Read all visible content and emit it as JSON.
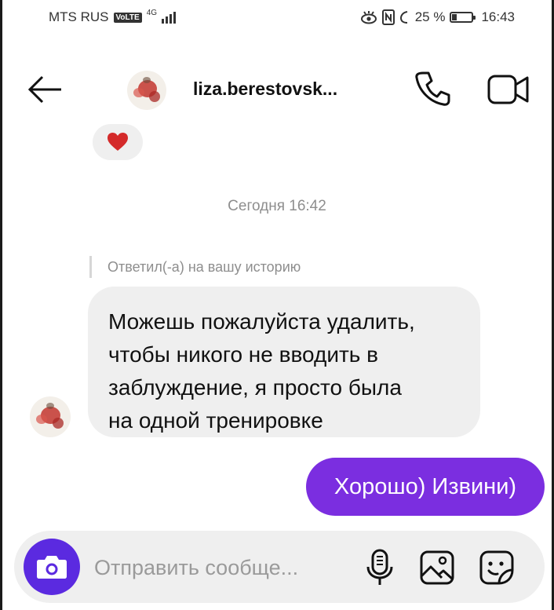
{
  "status_bar": {
    "carrier": "MTS RUS",
    "volte": "VoLTE",
    "network": "4G",
    "battery_text": "25 %",
    "battery_level_percent": 25,
    "time": "16:43"
  },
  "header": {
    "username": "liza.berestovsk..."
  },
  "chat": {
    "reaction_emoji": "❤",
    "date_separator": "Сегодня 16:42",
    "reply_note": "Ответил(-а) на вашу историю",
    "incoming_message": {
      "lines": [
        "Можешь пожалуйста удалить,",
        "чтобы никого не вводить в",
        "заблуждение, я просто была",
        "на одной тренировке"
      ]
    },
    "outgoing_message": "Хорошо) Извини)"
  },
  "composer": {
    "placeholder": "Отправить сообще..."
  },
  "colors": {
    "outgoing_bubble": "#7b2ee0",
    "camera_button": "#5b2ae0",
    "incoming_bubble": "#efefef",
    "heart": "#d42a2a"
  }
}
